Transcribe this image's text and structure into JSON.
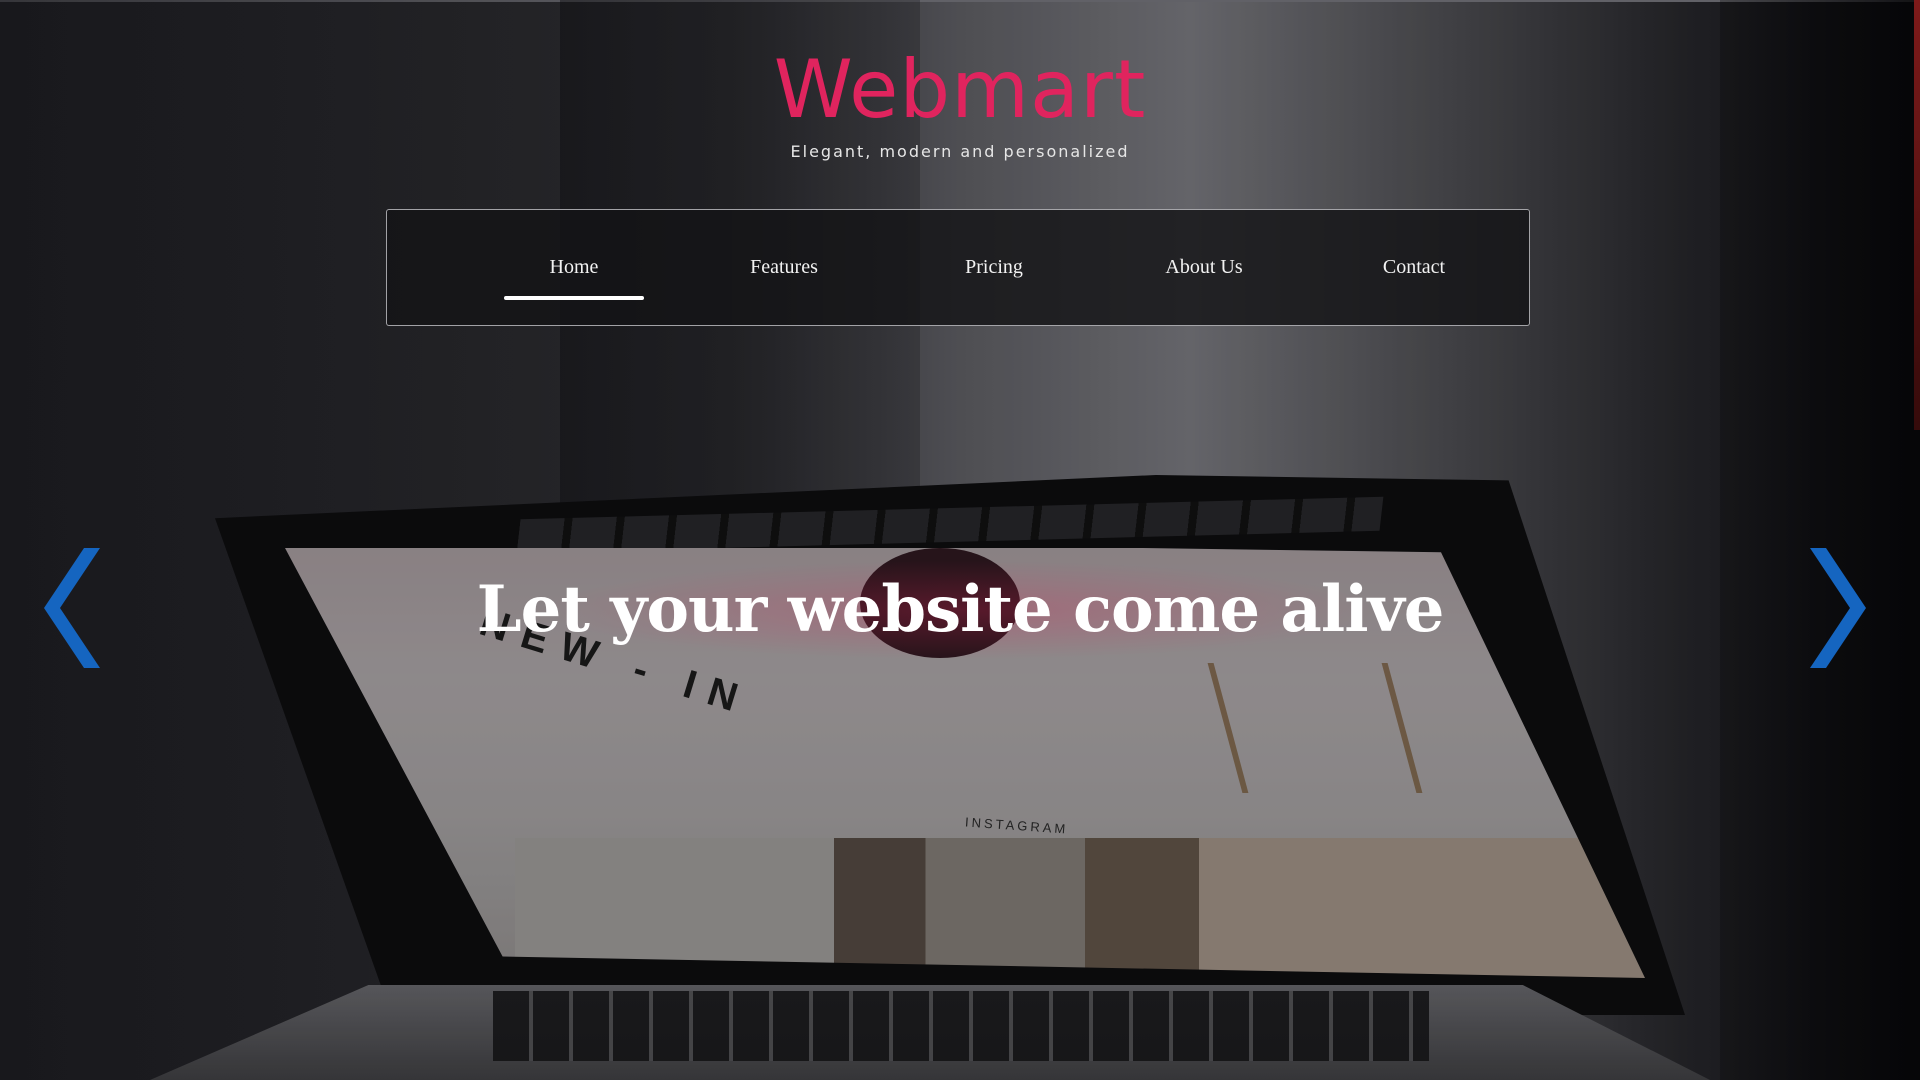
{
  "brand": {
    "logo": "Webmart",
    "tagline": "Elegant, modern and personalized"
  },
  "nav": {
    "items": [
      {
        "label": "Home",
        "active": true
      },
      {
        "label": "Features",
        "active": false
      },
      {
        "label": "Pricing",
        "active": false
      },
      {
        "label": "About Us",
        "active": false
      },
      {
        "label": "Contact",
        "active": false
      }
    ]
  },
  "hero": {
    "headline": "Let your website come alive",
    "screen_text": {
      "new_in": "NEW - IN",
      "instagram": "INSTAGRAM"
    }
  },
  "carousel": {
    "prev_icon": "chevron-left-icon",
    "next_icon": "chevron-right-icon",
    "arrow_color": "#1565c0"
  },
  "colors": {
    "brand": "#e0245e",
    "nav_text": "#f2f2f2",
    "headline": "#ffffff"
  }
}
